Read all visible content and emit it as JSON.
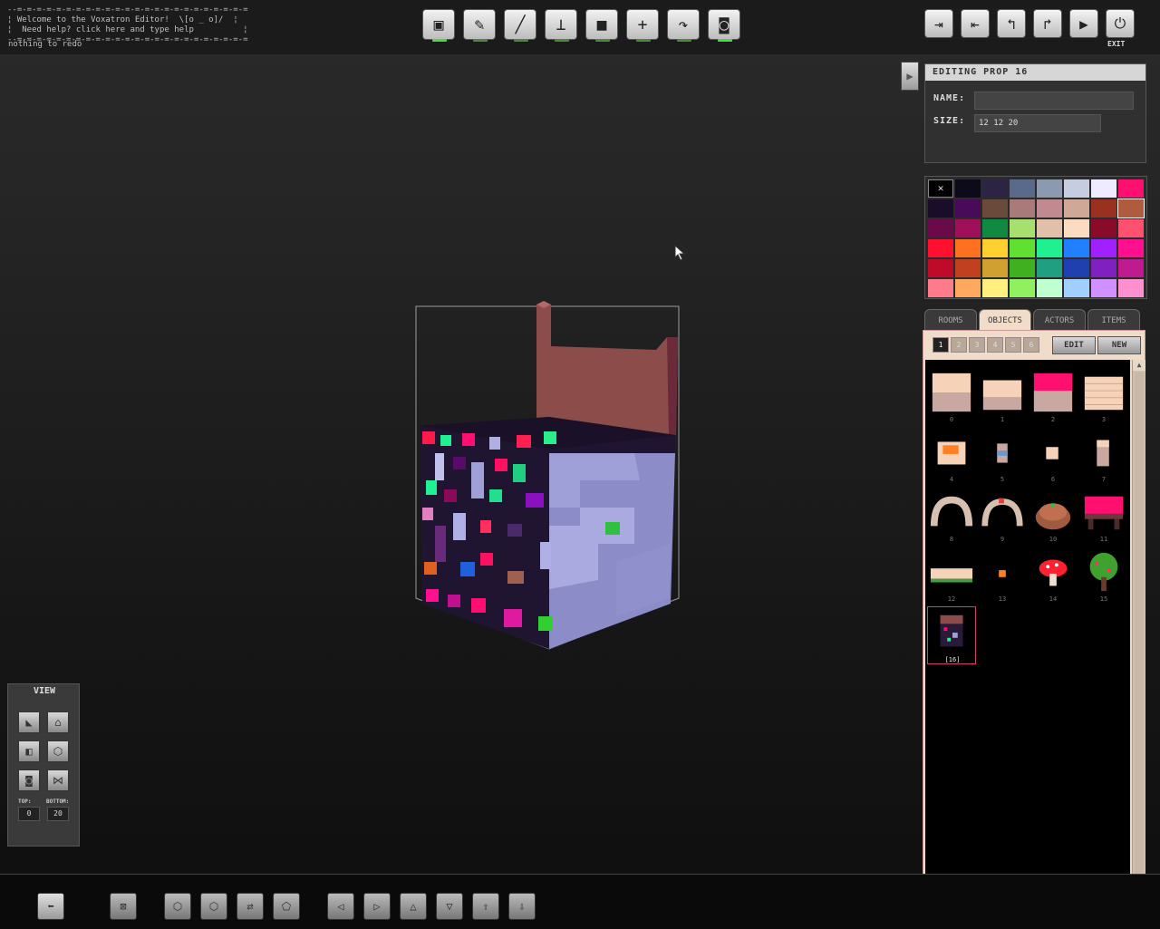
{
  "message": {
    "line1": "¦ Welcome to the Voxatron Editor!  \\[o _ o]/  ¦",
    "line2": "¦  Need help? click here and type help          ¦",
    "status": "nothing to redo"
  },
  "toolbar": {
    "tools": [
      "cube-tool-icon",
      "pencil-icon",
      "line-icon",
      "stamp-icon",
      "fill-square-icon",
      "crosshair-icon",
      "rotate-icon",
      "camera-icon"
    ],
    "right": [
      "save-as-icon",
      "load-icon",
      "undo-icon",
      "redo-icon",
      "play-icon",
      "power-icon"
    ],
    "exit_label": "EXIT"
  },
  "edit_panel": {
    "title": "EDITING PROP 16",
    "name_label": "NAME:",
    "name_value": "",
    "size_label": "SIZE:",
    "size_value": "12 12 20"
  },
  "palette": {
    "colors": [
      "#000000",
      "#0d0a1a",
      "#2b2444",
      "#5a6a8a",
      "#8c9ab0",
      "#c6cde0",
      "#eeeaff",
      "#ff1070",
      "#1a0d2a",
      "#4a0a5a",
      "#6a4a3a",
      "#a87a7a",
      "#c08a90",
      "#d0a898",
      "#9a3020",
      "#b05a40",
      "#6a0a4a",
      "#a0105a",
      "#108a40",
      "#a8e070",
      "#e0c0a8",
      "#fbdcc0",
      "#8a0a2a",
      "#ff5070",
      "#ff1030",
      "#ff7020",
      "#ffd030",
      "#60e030",
      "#20f090",
      "#2080ff",
      "#a020ff",
      "#ff1090",
      "#c00a2a",
      "#c04020",
      "#d0a030",
      "#40b020",
      "#20a080",
      "#2040b0",
      "#8020c0",
      "#c01a90",
      "#ff7a8a",
      "#ffa860",
      "#fff080",
      "#90f060",
      "#c0ffd0",
      "#a0d0ff",
      "#d090ff",
      "#ff90d0"
    ]
  },
  "tabs": [
    "ROOMS",
    "OBJECTS",
    "ACTORS",
    "ITEMS"
  ],
  "object_panel": {
    "pages": [
      "1",
      "2",
      "3",
      "4",
      "5",
      "6"
    ],
    "edit_label": "EDIT",
    "new_label": "NEW",
    "objects": [
      "0",
      "1",
      "2",
      "3",
      "4",
      "5",
      "6",
      "7",
      "8",
      "9",
      "10",
      "11",
      "12",
      "13",
      "14",
      "15",
      "[16]"
    ]
  },
  "view_panel": {
    "title": "VIEW",
    "top_label": "TOP:",
    "bottom_label": "BOTTOM:",
    "top_value": "0",
    "bottom_value": "20"
  },
  "bottom_toolbar": {
    "buttons": [
      "back-arrow-icon",
      "clear-icon",
      "view-front-icon",
      "view-top-icon",
      "flip-icon",
      "tilt-icon",
      "shift-left-icon",
      "shift-right-icon",
      "shift-back-icon",
      "shift-front-icon",
      "shift-up-icon",
      "shift-down-icon"
    ]
  }
}
